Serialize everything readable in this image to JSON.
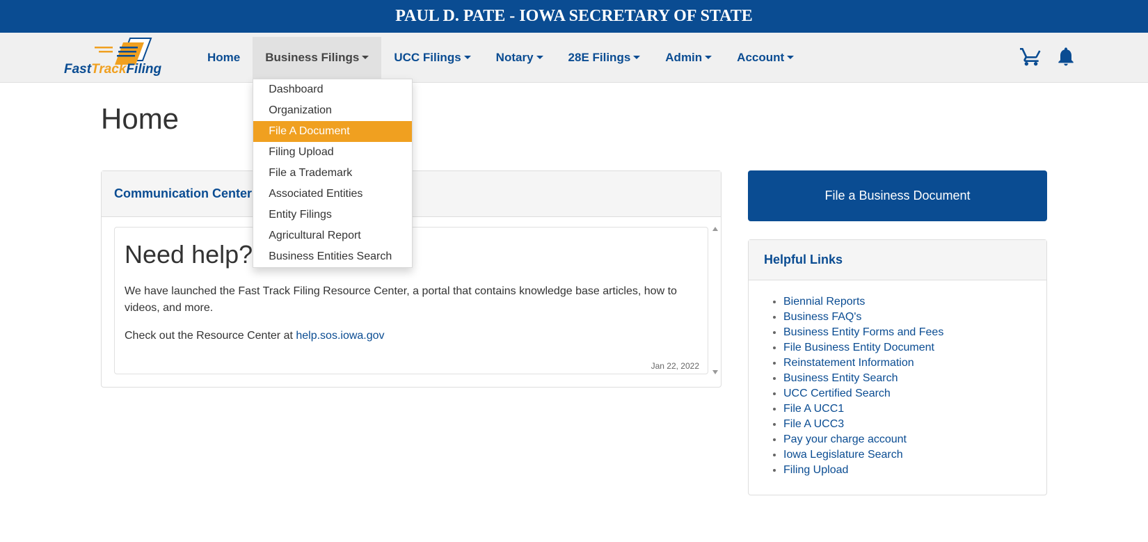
{
  "header": {
    "banner": "PAUL D. PATE - IOWA SECRETARY OF STATE"
  },
  "logo": {
    "fast": "Fast",
    "track": "Track",
    "filing": "Filing"
  },
  "nav": {
    "home": "Home",
    "business": "Business Filings",
    "ucc": "UCC Filings",
    "notary": "Notary",
    "e28": "28E Filings",
    "admin": "Admin",
    "account": "Account"
  },
  "dropdown": {
    "dashboard": "Dashboard",
    "organization": "Organization",
    "file_doc": "File A Document",
    "filing_upload": "Filing Upload",
    "trademark": "File a Trademark",
    "assoc": "Associated Entities",
    "entity_filings": "Entity Filings",
    "ag_report": "Agricultural Report",
    "search": "Business Entities Search"
  },
  "page": {
    "title": "Home"
  },
  "comm": {
    "title": "Communication Center",
    "card_title": "Need help?",
    "p1": "We have launched the Fast Track Filing Resource Center, a portal that contains knowledge base articles, how to videos, and more.",
    "p2_prefix": "Check out the Resource Center at ",
    "p2_link": "help.sos.iowa.gov",
    "date": "Jan 22, 2022"
  },
  "cta": {
    "label": "File a Business Document"
  },
  "links": {
    "title": "Helpful Links",
    "items": [
      "Biennial Reports",
      "Business FAQ's",
      "Business Entity Forms and Fees",
      "File Business Entity Document",
      "Reinstatement Information",
      "Business Entity Search",
      "UCC Certified Search",
      "File A UCC1",
      "File A UCC3",
      "Pay your charge account",
      "Iowa Legislature Search",
      "Filing Upload"
    ]
  }
}
